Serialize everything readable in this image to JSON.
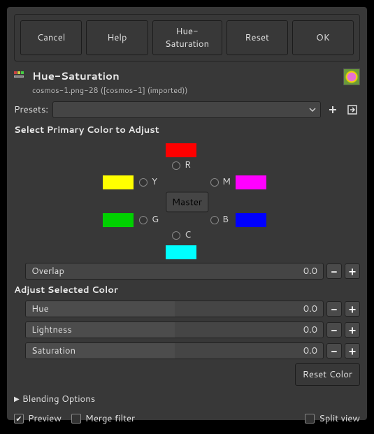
{
  "buttons": {
    "cancel": "Cancel",
    "help": "Help",
    "main": "Hue-Saturation",
    "reset": "Reset",
    "ok": "OK",
    "reset_color": "Reset Color"
  },
  "title": "Hue-Saturation",
  "subtitle": "cosmos-1.png-28 ([cosmos-1] (imported))",
  "presets_label": "Presets:",
  "section_primary": "Select Primary Color to Adjust",
  "section_adjust": "Adjust Selected Color",
  "colors": {
    "R": {
      "label": "R",
      "hex": "#ff0000"
    },
    "Y": {
      "label": "Y",
      "hex": "#ffff00"
    },
    "G": {
      "label": "G",
      "hex": "#00d000"
    },
    "C": {
      "label": "C",
      "hex": "#00ffff"
    },
    "B": {
      "label": "B",
      "hex": "#0000ff"
    },
    "M": {
      "label": "M",
      "hex": "#ff00ff"
    }
  },
  "master": "Master",
  "sliders": {
    "overlap": {
      "label": "Overlap",
      "value": "0.0"
    },
    "hue": {
      "label": "Hue",
      "value": "0.0"
    },
    "lightness": {
      "label": "Lightness",
      "value": "0.0"
    },
    "saturation": {
      "label": "Saturation",
      "value": "0.0"
    }
  },
  "blending": "Blending Options",
  "preview": "Preview",
  "merge_filter": "Merge filter",
  "split_view": "Split view"
}
